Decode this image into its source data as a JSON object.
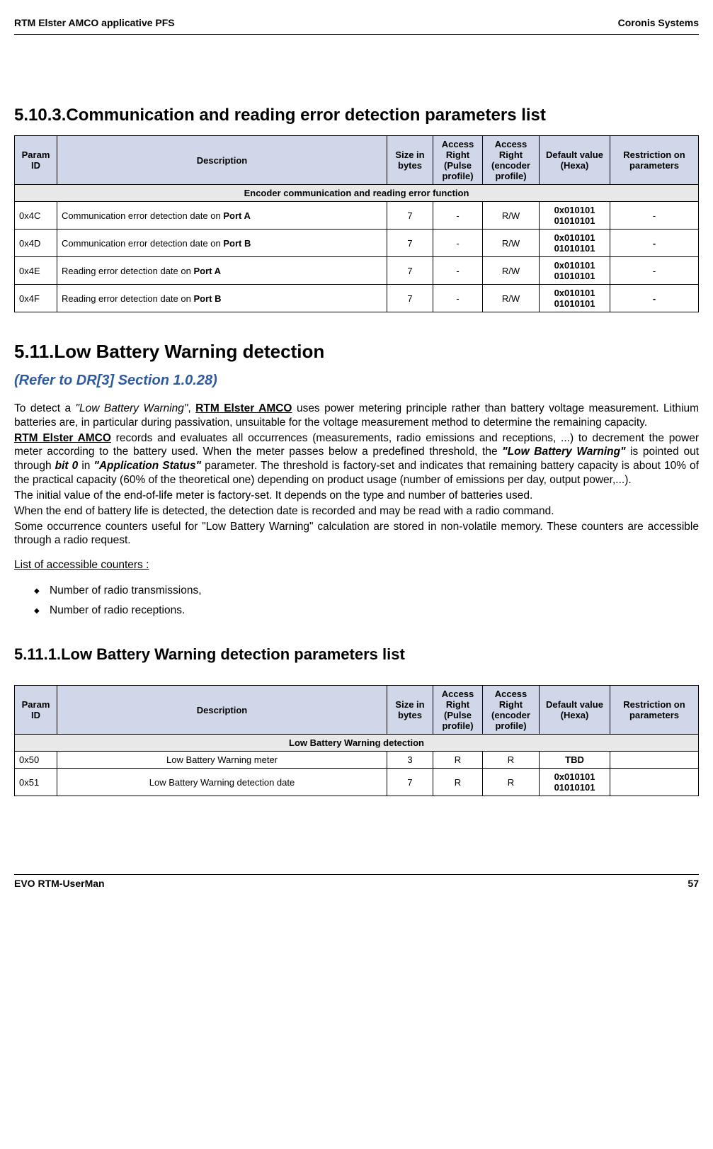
{
  "header": {
    "left": "RTM Elster AMCO applicative PFS",
    "right": "Coronis Systems"
  },
  "section_5_10_3": {
    "heading": "5.10.3.Communication and reading error detection parameters list"
  },
  "table1": {
    "headers": {
      "param_id": "Param ID",
      "description": "Description",
      "size": "Size in bytes",
      "access_pulse": "Access Right (Pulse profile)",
      "access_encoder": "Access Right (encoder profile)",
      "default": "Default value (Hexa)",
      "restriction": "Restriction on parameters"
    },
    "section_title": "Encoder communication and reading error function",
    "rows": [
      {
        "id": "0x4C",
        "desc_prefix": "Communication error detection date on ",
        "desc_bold": "Port A",
        "size": "7",
        "pulse": "-",
        "encoder": "R/W",
        "default1": "0x010101",
        "default2": "01010101",
        "restriction": "-"
      },
      {
        "id": "0x4D",
        "desc_prefix": "Communication error detection date on ",
        "desc_bold": "Port B",
        "size": "7",
        "pulse": "-",
        "encoder": "R/W",
        "default1": "0x010101",
        "default2": "01010101",
        "restriction": "-"
      },
      {
        "id": "0x4E",
        "desc_prefix": "Reading error detection date on ",
        "desc_bold": "Port A",
        "size": "7",
        "pulse": "-",
        "encoder": "R/W",
        "default1": "0x010101",
        "default2": "01010101",
        "restriction": "-"
      },
      {
        "id": "0x4F",
        "desc_prefix": "Reading error detection date on ",
        "desc_bold": "Port B",
        "size": "7",
        "pulse": "-",
        "encoder": "R/W",
        "default1": "0x010101",
        "default2": "01010101",
        "restriction": "-"
      }
    ]
  },
  "section_5_11": {
    "heading": "5.11.Low Battery Warning detection",
    "subheading": "(Refer to DR[3] Section 1.0.28)"
  },
  "paragraphs": {
    "p1_a": "To detect a ",
    "p1_b": "\"Low Battery Warning\"",
    "p1_c": ", ",
    "p1_d": "RTM Elster AMCO",
    "p1_e": " uses power metering principle rather than battery voltage measurement. Lithium batteries are, in particular during passivation, unsuitable for the voltage measurement method to determine the remaining capacity.",
    "p2_a": "RTM Elster AMCO",
    "p2_b": " records and evaluates all occurrences (measurements, radio emissions and receptions, ...) to decrement the power meter according to the battery used. When the meter passes below a predefined threshold, the ",
    "p2_c": "\"Low Battery Warning\"",
    "p2_d": " is pointed out through ",
    "p2_e": "bit 0",
    "p2_f": " in ",
    "p2_g": "\"Application Status\"",
    "p2_h": " parameter. The threshold is factory-set and indicates that remaining battery capacity is about 10% of the practical capacity (60% of the theoretical one) depending on product usage (number of emissions per day, output power,...).",
    "p3": "The initial value of the end-of-life meter is factory-set. It depends on the type and number of batteries used.",
    "p4": "When the end of battery life is detected, the detection date is recorded and may be read with a radio command.",
    "p5": "Some occurrence counters useful for \"Low Battery Warning\" calculation are stored in non-volatile memory. These counters are accessible through a radio request."
  },
  "list_heading": "List of accessible counters :",
  "list_items": {
    "item1": "Number of radio transmissions,",
    "item2": "Number of radio receptions."
  },
  "section_5_11_1": {
    "heading": "5.11.1.Low Battery Warning detection parameters list"
  },
  "table2": {
    "section_title": "Low Battery Warning detection",
    "rows": [
      {
        "id": "0x50",
        "desc": "Low  Battery Warning meter",
        "size": "3",
        "pulse": "R",
        "encoder": "R",
        "default": "TBD",
        "restriction": ""
      },
      {
        "id": "0x51",
        "desc": "Low Battery Warning detection date",
        "size": "7",
        "pulse": "R",
        "encoder": "R",
        "default1": "0x010101",
        "default2": "01010101",
        "restriction": ""
      }
    ]
  },
  "footer": {
    "left": "EVO RTM-UserMan",
    "right": "57"
  }
}
